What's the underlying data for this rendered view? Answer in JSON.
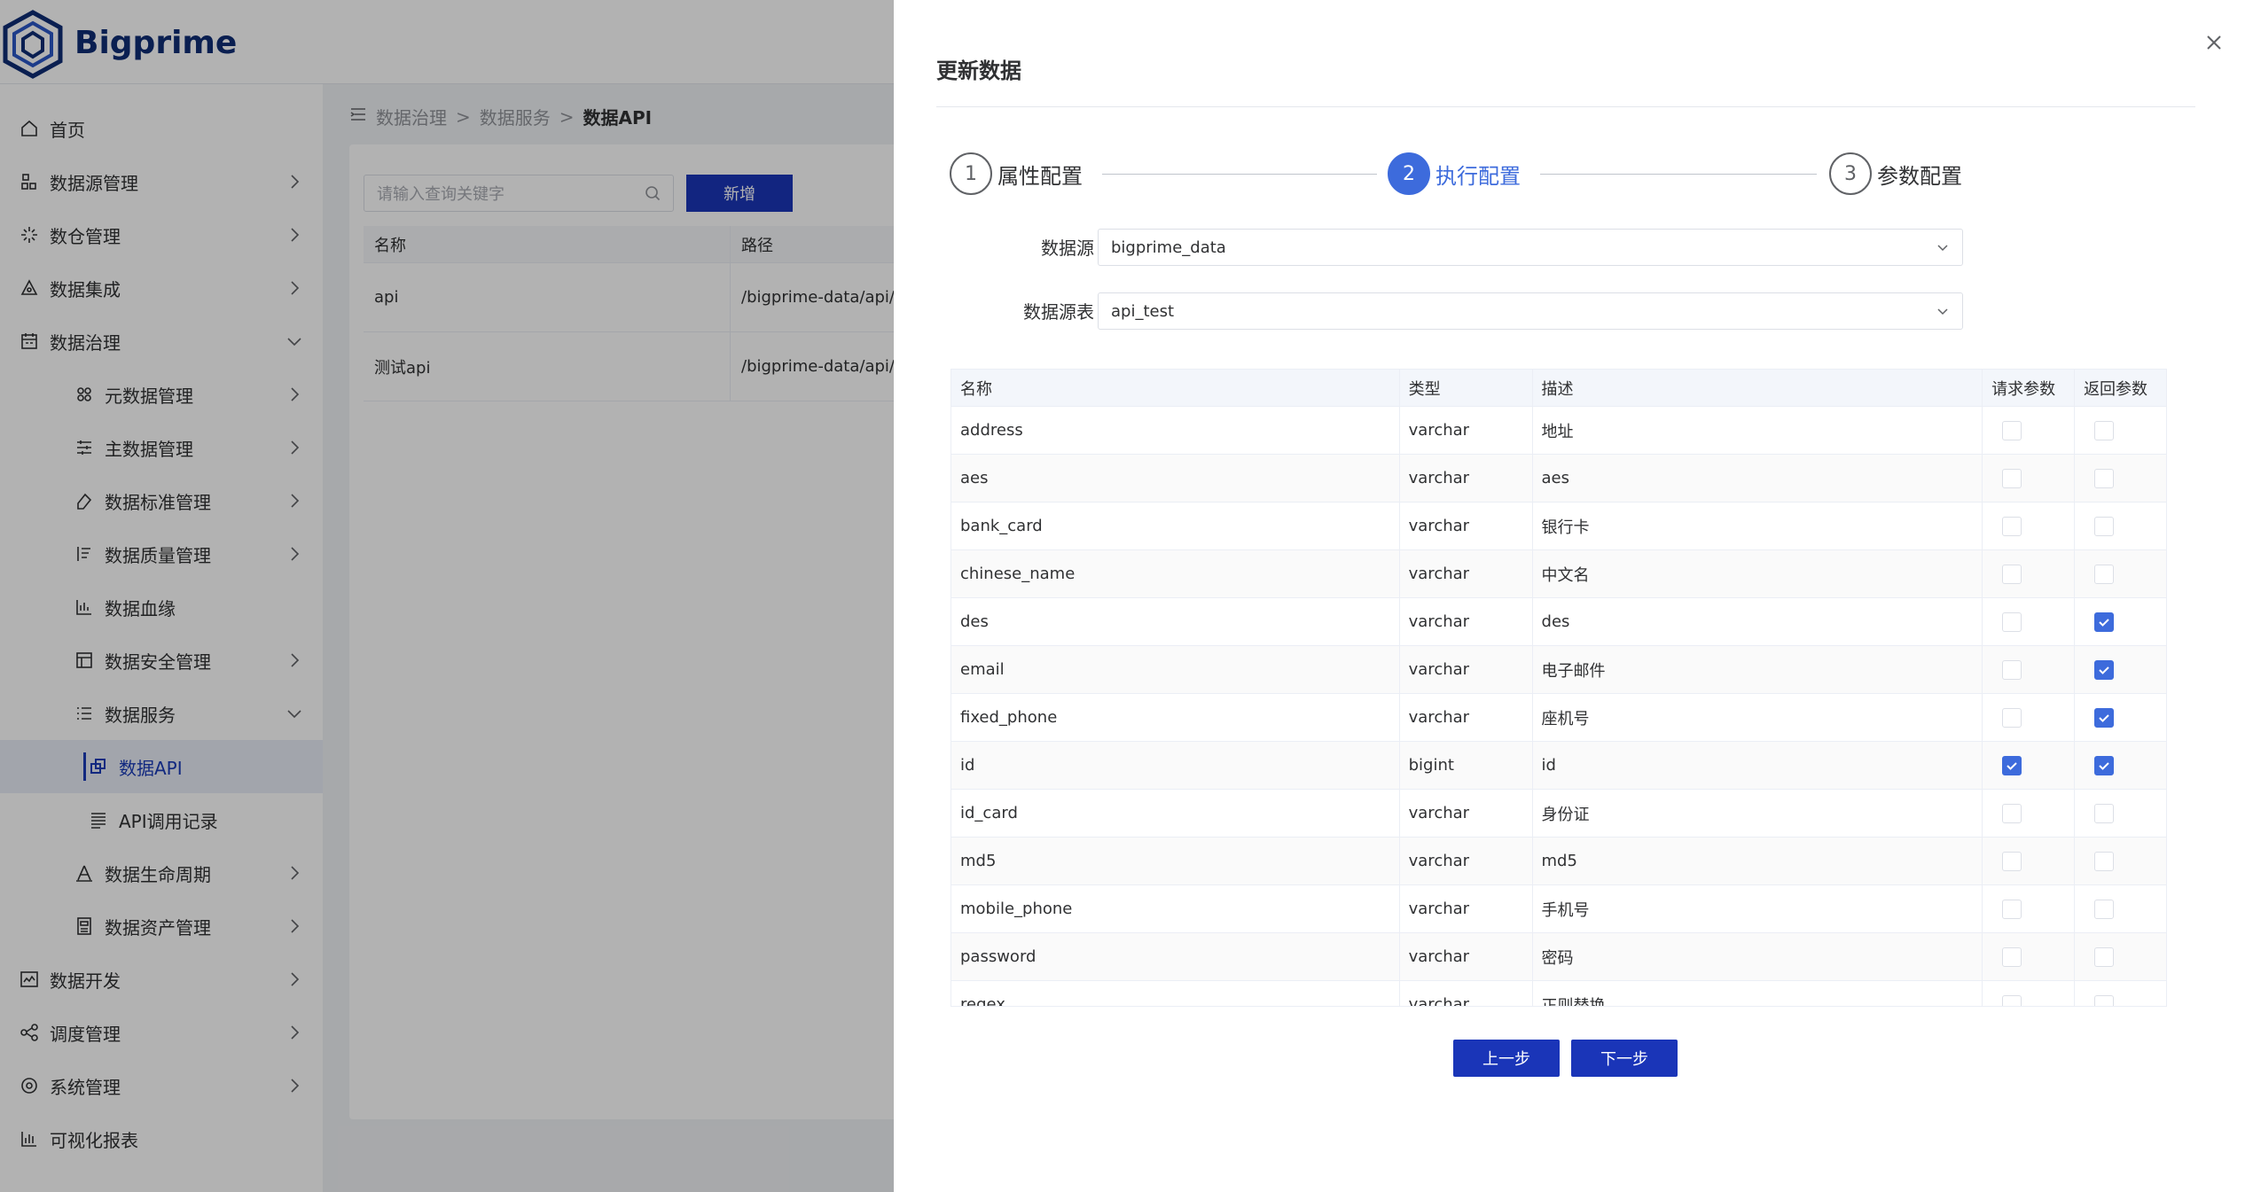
{
  "app": {
    "brand": "Bigprime"
  },
  "sidebar": {
    "items": [
      {
        "label": "首页",
        "icon": "home-icon",
        "expandable": false
      },
      {
        "label": "数据源管理",
        "icon": "datasource-icon",
        "expandable": true
      },
      {
        "label": "数仓管理",
        "icon": "warehouse-icon",
        "expandable": true
      },
      {
        "label": "数据集成",
        "icon": "integration-icon",
        "expandable": true
      },
      {
        "label": "数据治理",
        "icon": "governance-icon",
        "expandable": true,
        "expanded": true
      },
      {
        "label": "元数据管理",
        "icon": "metadata-icon",
        "expandable": true,
        "sub": true
      },
      {
        "label": "主数据管理",
        "icon": "master-data-icon",
        "expandable": true,
        "sub": true
      },
      {
        "label": "数据标准管理",
        "icon": "standard-icon",
        "expandable": true,
        "sub": true
      },
      {
        "label": "数据质量管理",
        "icon": "quality-icon",
        "expandable": true,
        "sub": true
      },
      {
        "label": "数据血缘",
        "icon": "lineage-chart-icon",
        "expandable": false,
        "sub": true
      },
      {
        "label": "数据安全管理",
        "icon": "security-icon",
        "expandable": true,
        "sub": true
      },
      {
        "label": "数据服务",
        "icon": "service-icon",
        "expandable": true,
        "expanded": true,
        "sub": true
      },
      {
        "label": "数据API",
        "icon": "api-icon",
        "expandable": false,
        "sub2": true,
        "active": true
      },
      {
        "label": "API调用记录",
        "icon": "record-list-icon",
        "expandable": false,
        "sub2": true
      },
      {
        "label": "数据生命周期",
        "icon": "lifecycle-icon",
        "expandable": true,
        "sub": true
      },
      {
        "label": "数据资产管理",
        "icon": "asset-icon",
        "expandable": true,
        "sub": true
      },
      {
        "label": "数据开发",
        "icon": "develop-icon",
        "expandable": true
      },
      {
        "label": "调度管理",
        "icon": "schedule-icon",
        "expandable": true
      },
      {
        "label": "系统管理",
        "icon": "settings-icon",
        "expandable": true
      },
      {
        "label": "可视化报表",
        "icon": "report-chart-icon",
        "expandable": false
      }
    ]
  },
  "breadcrumb": [
    "数据治理",
    "数据服务",
    "数据API"
  ],
  "list_page": {
    "search_placeholder": "请输入查询关键字",
    "add_label": "新增",
    "columns": [
      "名称",
      "路径"
    ],
    "rows": [
      {
        "name": "api",
        "path": "/bigprime-data/api/dat"
      },
      {
        "name": "测试api",
        "path": "/bigprime-data/api/dat"
      }
    ]
  },
  "drawer": {
    "title": "更新数据",
    "steps": [
      {
        "num": "1",
        "label": "属性配置",
        "active": false
      },
      {
        "num": "2",
        "label": "执行配置",
        "active": true
      },
      {
        "num": "3",
        "label": "参数配置",
        "active": false
      }
    ],
    "form": {
      "datasource_label": "数据源",
      "datasource_value": "bigprime_data",
      "table_label": "数据源表",
      "table_value": "api_test"
    },
    "table": {
      "columns": [
        "名称",
        "类型",
        "描述",
        "请求参数",
        "返回参数"
      ],
      "rows": [
        {
          "name": "address",
          "type": "varchar",
          "desc": "地址",
          "req": false,
          "ret": false
        },
        {
          "name": "aes",
          "type": "varchar",
          "desc": "aes",
          "req": false,
          "ret": false
        },
        {
          "name": "bank_card",
          "type": "varchar",
          "desc": "银行卡",
          "req": false,
          "ret": false
        },
        {
          "name": "chinese_name",
          "type": "varchar",
          "desc": "中文名",
          "req": false,
          "ret": false
        },
        {
          "name": "des",
          "type": "varchar",
          "desc": "des",
          "req": false,
          "ret": true
        },
        {
          "name": "email",
          "type": "varchar",
          "desc": "电子邮件",
          "req": false,
          "ret": true
        },
        {
          "name": "fixed_phone",
          "type": "varchar",
          "desc": "座机号",
          "req": false,
          "ret": true
        },
        {
          "name": "id",
          "type": "bigint",
          "desc": "id",
          "req": true,
          "ret": true
        },
        {
          "name": "id_card",
          "type": "varchar",
          "desc": "身份证",
          "req": false,
          "ret": false
        },
        {
          "name": "md5",
          "type": "varchar",
          "desc": "md5",
          "req": false,
          "ret": false
        },
        {
          "name": "mobile_phone",
          "type": "varchar",
          "desc": "手机号",
          "req": false,
          "ret": false
        },
        {
          "name": "password",
          "type": "varchar",
          "desc": "密码",
          "req": false,
          "ret": false
        },
        {
          "name": "regex",
          "type": "varchar",
          "desc": "正则替换",
          "req": false,
          "ret": false
        }
      ]
    },
    "prev_label": "上一步",
    "next_label": "下一步"
  },
  "colors": {
    "primary": "#1a35b8",
    "accent": "#3d6bdc"
  }
}
